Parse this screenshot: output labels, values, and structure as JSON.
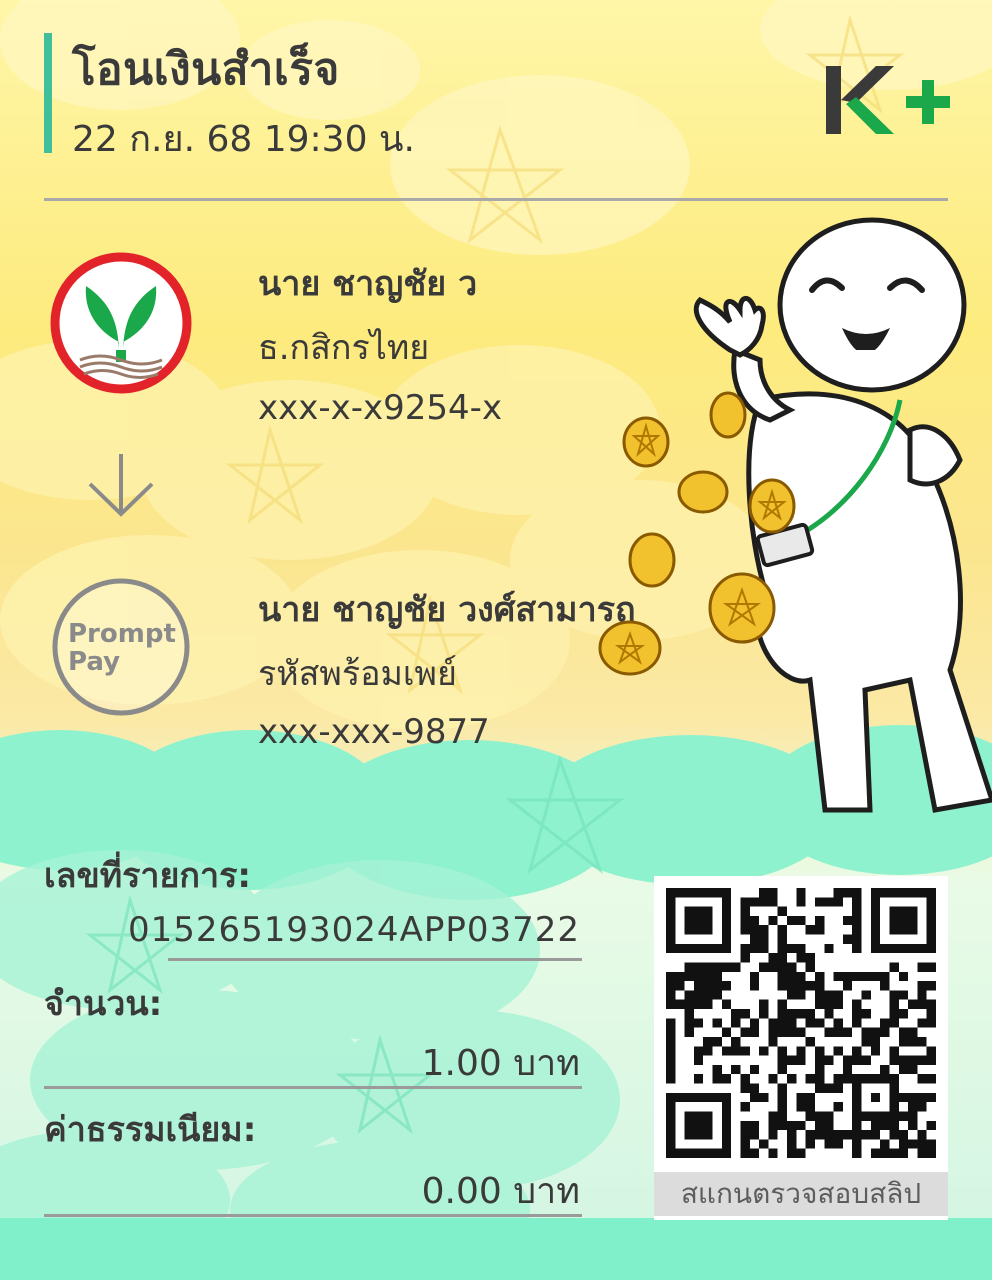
{
  "header": {
    "title": "โอนเงินสำเร็จ",
    "datetime": "22 ก.ย. 68  19:30 น.",
    "brand": "K+"
  },
  "sender": {
    "name": "นาย ชาญชัย ว",
    "bank": "ธ.กสิกรไทย",
    "account": "xxx-x-x9254-x",
    "logo_icon": "kasikornbank-logo-icon"
  },
  "receiver": {
    "name": "นาย ชาญชัย วงศ์สามารถ",
    "bank": "รหัสพร้อมเพย์",
    "account": "xxx-xxx-9877",
    "logo_icon": "promptpay-logo-icon",
    "logo_text_line1": "Prompt",
    "logo_text_line2": "Pay"
  },
  "transaction": {
    "ref_label": "เลขที่รายการ:",
    "ref_value": "015265193024APP03722",
    "amount_label": "จำนวน:",
    "amount_value": "1.00 บาท",
    "fee_label": "ค่าธรรมเนียม:",
    "fee_value": "0.00 บาท"
  },
  "qr": {
    "caption": "สแกนตรวจสอบสลิป"
  },
  "colors": {
    "accent_teal": "#3fc09a",
    "kbank_green": "#1ba84b",
    "kbank_red": "#e3232a",
    "bottom_bar": "#7ff0c9",
    "background_yellow": "#fdeb7e",
    "background_mint": "#d5f6e3"
  }
}
